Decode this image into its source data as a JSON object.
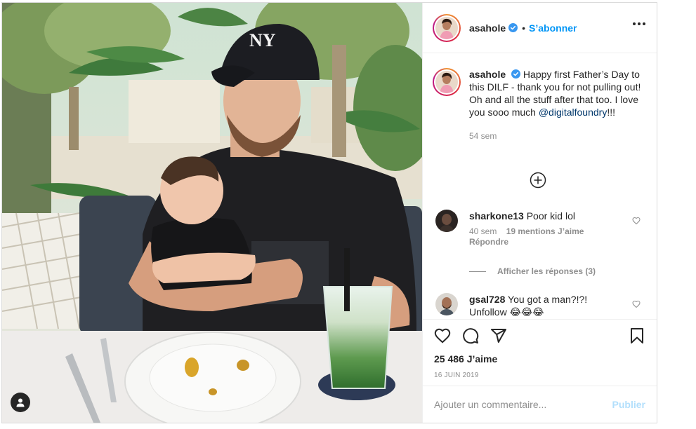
{
  "post": {
    "username": "asahole",
    "follow_label": "S’abonner",
    "dot": "•",
    "caption": {
      "username": "asahole",
      "text_before": "Happy first Father’s Day to this DILF - thank you for not pulling out! Oh and all the stuff after that too. I love you sooo much ",
      "mention": "@digitalfoundry",
      "text_after": "!!!",
      "time": "54 sem"
    },
    "comments": [
      {
        "username": "sharkone13",
        "text": "Poor kid lol",
        "time": "40 sem",
        "likes": "19 mentions J’aime",
        "reply": "Répondre",
        "view_replies": "Afficher les réponses (3)"
      },
      {
        "username": "gsal728",
        "text": "You got a man?!?! Unfollow 😂😂😂"
      }
    ],
    "likes": "25 486 J’aime",
    "date": "16 JUIN 2019",
    "add_comment_placeholder": "Ajouter un commentaire...",
    "publish_label": "Publier",
    "icons": {
      "more": "more-options-icon",
      "verified": "verified-badge-icon",
      "load_more": "plus-circle-icon",
      "like": "heart-icon",
      "comment": "comment-bubble-icon",
      "share": "paper-plane-icon",
      "save": "bookmark-icon",
      "tag": "user-tag-icon"
    }
  },
  "colors": {
    "accent": "#0095f6",
    "publish_disabled": "#b2dffc",
    "text": "#262626",
    "muted": "#8e8e8e",
    "border": "#dbdbdb"
  }
}
